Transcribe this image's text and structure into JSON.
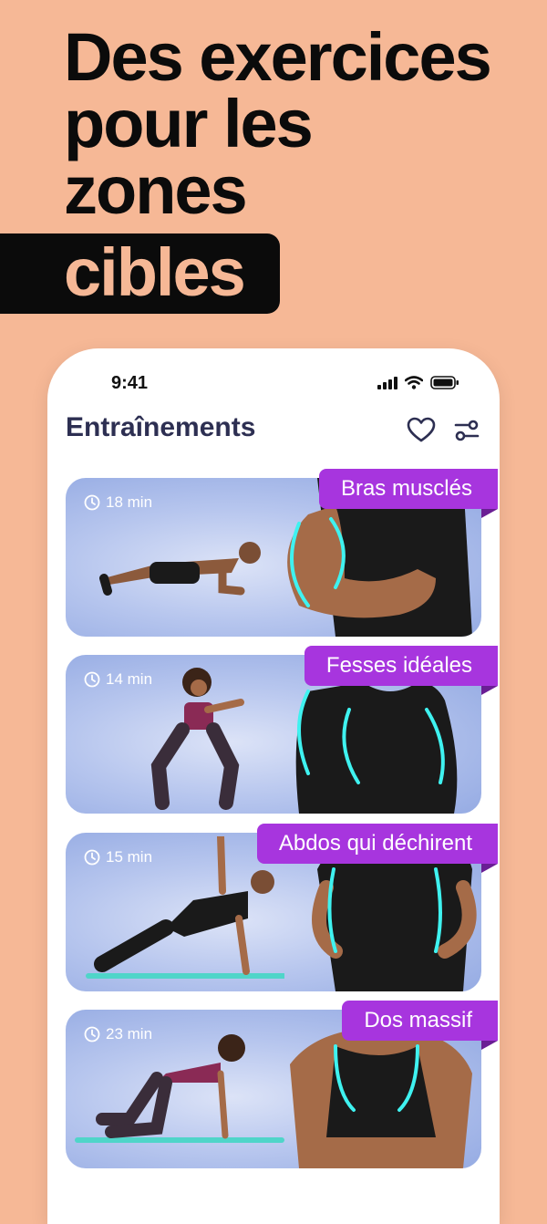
{
  "headline": {
    "lines": [
      "Des exercices",
      "pour les",
      "zones"
    ],
    "highlight": "cibles"
  },
  "status_bar": {
    "time": "9:41"
  },
  "header": {
    "title": "Entraînements"
  },
  "workouts": [
    {
      "duration": "18 min",
      "label": "Bras musclés"
    },
    {
      "duration": "14 min",
      "label": "Fesses idéales"
    },
    {
      "duration": "15 min",
      "label": "Abdos qui déchirent"
    },
    {
      "duration": "23 min",
      "label": "Dos massif"
    }
  ],
  "colors": {
    "background": "#F6B896",
    "tag": "#A735DE",
    "title": "#2D2F52",
    "glow": "#3FF2F0"
  }
}
